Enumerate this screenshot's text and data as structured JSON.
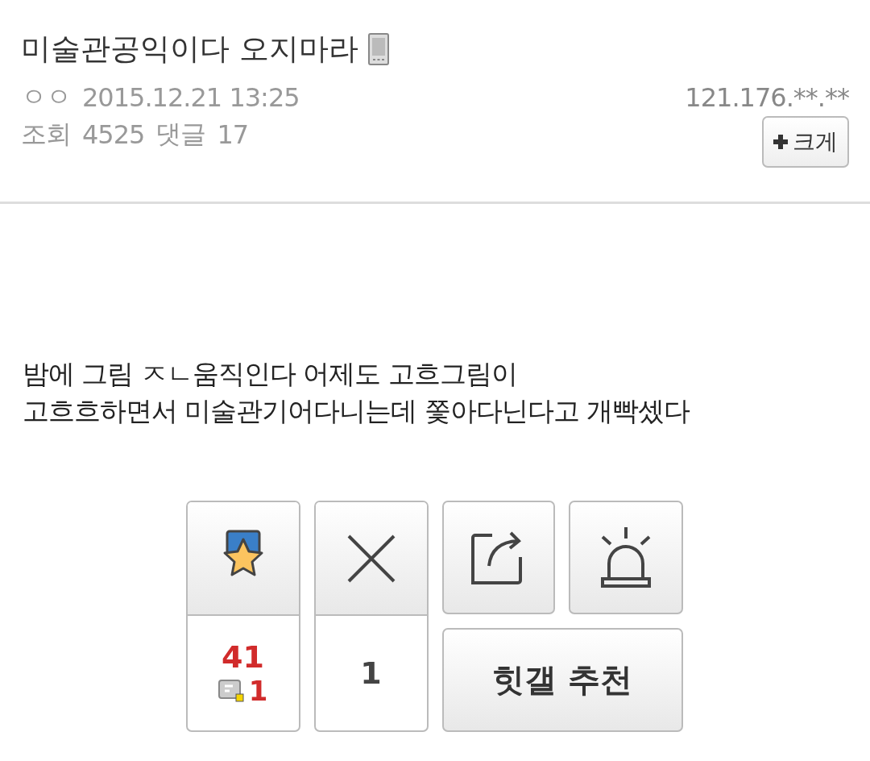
{
  "post": {
    "title": "미술관공익이다 오지마라",
    "author": "ㅇㅇ",
    "date": "2015.12.21 13:25",
    "ip": "121.176.**.**",
    "views_label": "조회",
    "views": "4525",
    "comments_label": "댓글",
    "comments": "17",
    "font_button": "크게"
  },
  "body": [
    "밤에 그림 ㅈㄴ움직인다 어제도 고흐그림이",
    "고흐흐하면서 미술관기어다니는데 쫓아다닌다고 개빡셌다"
  ],
  "actions": {
    "recommend_count": "41",
    "mobile_recommend_count": "1",
    "unrecommend_count": "1",
    "hit_button": "힛갤 추천"
  }
}
